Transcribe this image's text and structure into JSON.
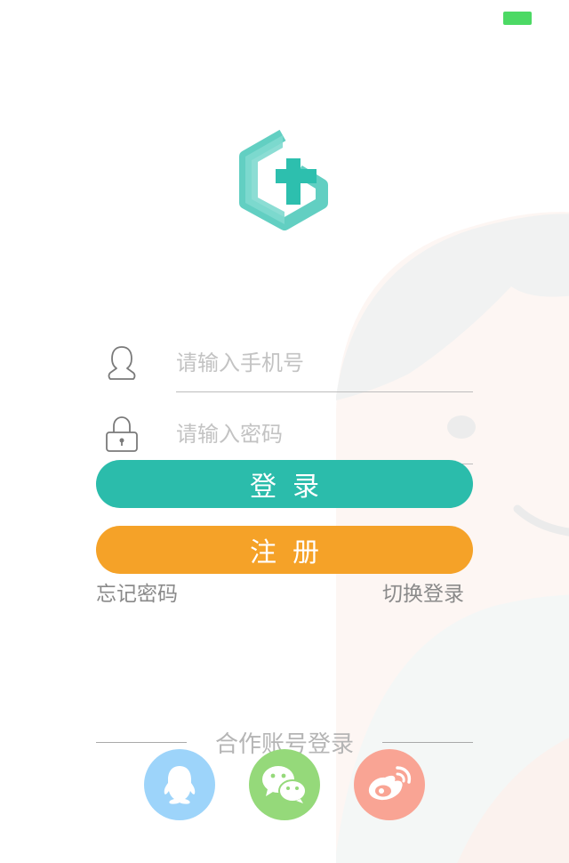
{
  "status_bar": {
    "battery_color": "#4cd964"
  },
  "logo": {
    "name": "app-logo",
    "color": "#2dbfae"
  },
  "login_form": {
    "phone_placeholder": "请输入手机号",
    "password_placeholder": "请输入密码",
    "phone_icon": "user-icon",
    "password_icon": "lock-icon",
    "login_label": "登录",
    "register_label": "注册",
    "forgot_label": "忘记密码",
    "switch_label": "切换登录"
  },
  "colors": {
    "accent": "#2bbcab",
    "register": "#f5a228",
    "qq": "#9dd4fa",
    "wechat": "#95d97a",
    "weibo": "#f9a494"
  },
  "partner": {
    "title": "合作账号登录",
    "items": [
      {
        "icon": "qq-icon"
      },
      {
        "icon": "wechat-icon"
      },
      {
        "icon": "weibo-icon"
      }
    ]
  }
}
